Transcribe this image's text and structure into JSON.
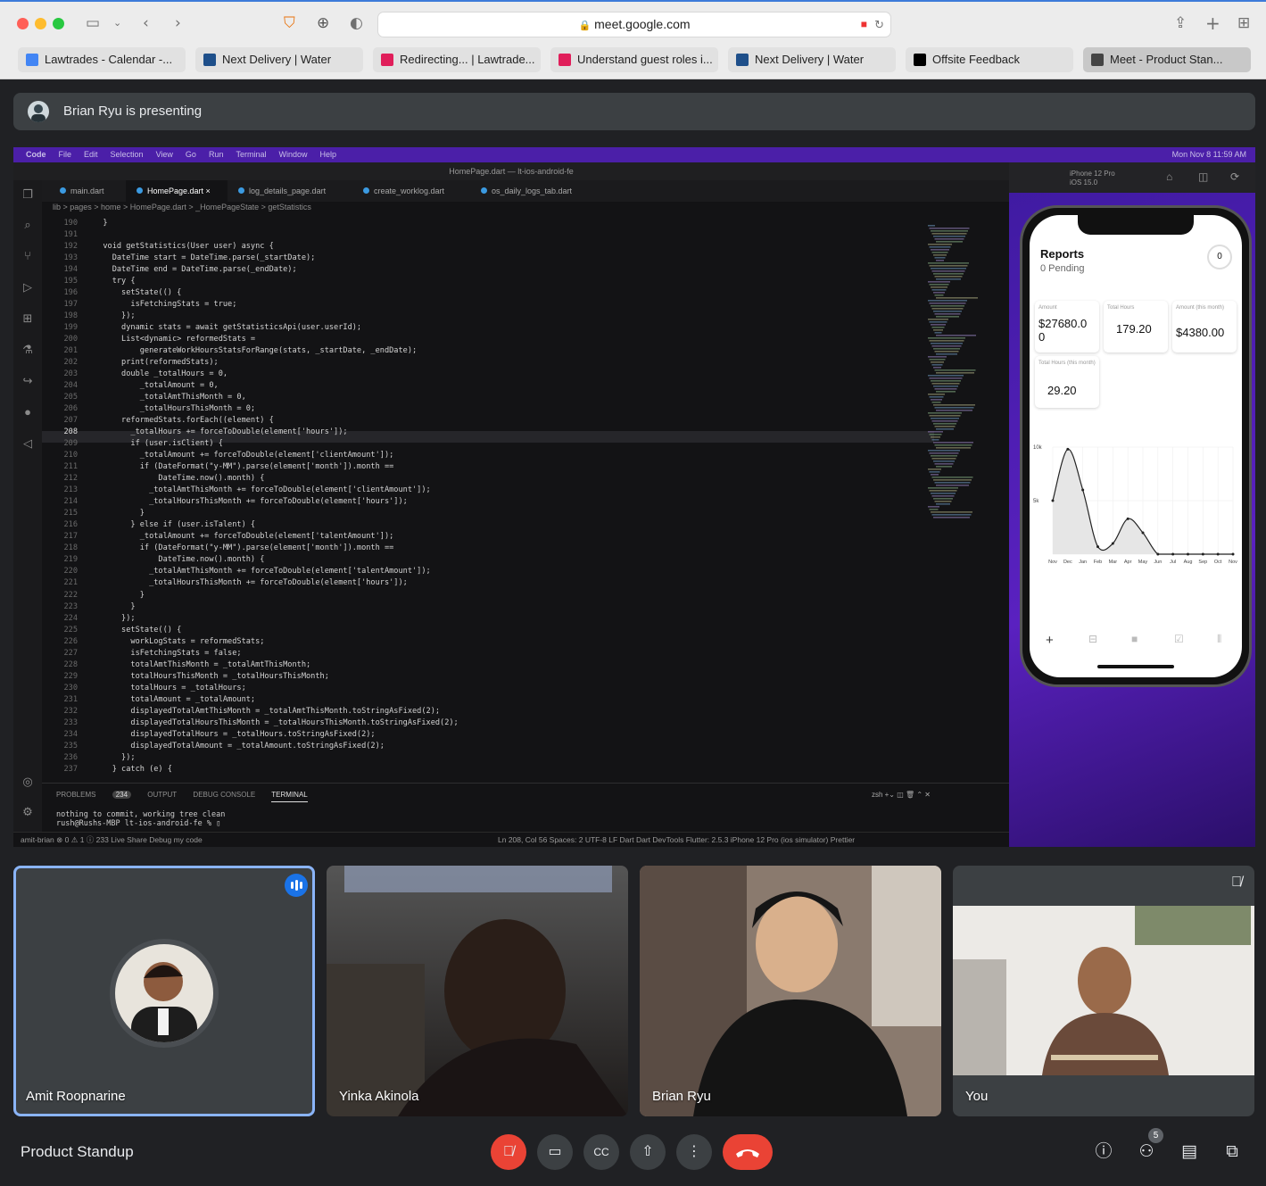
{
  "browser": {
    "url": "meet.google.com",
    "tabs": [
      {
        "label": "Lawtrades - Calendar -...",
        "color": "#4285f4"
      },
      {
        "label": "Next Delivery | Water",
        "color": "#1e4f8a"
      },
      {
        "label": "Redirecting... | Lawtrade...",
        "color": "#e01e5a"
      },
      {
        "label": "Understand guest roles i...",
        "color": "#e01e5a"
      },
      {
        "label": "Next Delivery | Water",
        "color": "#1e4f8a"
      },
      {
        "label": "Offsite Feedback",
        "color": "#000000"
      },
      {
        "label": "Meet - Product Stan...",
        "color": "#444444"
      }
    ]
  },
  "presenting": {
    "text": "Brian Ryu is presenting"
  },
  "shared": {
    "menubar": [
      "Code",
      "File",
      "Edit",
      "Selection",
      "View",
      "Go",
      "Run",
      "Terminal",
      "Window",
      "Help"
    ],
    "menubar_right": "Mon Nov 8  11:59 AM",
    "window_title": "HomePage.dart — lt-ios-android-fe",
    "editor_tabs": [
      "main.dart",
      "HomePage.dart",
      "log_details_page.dart",
      "create_worklog.dart",
      "os_daily_logs_tab.dart"
    ],
    "breadcrumb": "lib > pages > home > HomePage.dart > _HomePageState > getStatistics",
    "code_lines": [
      {
        "n": "190",
        "t": "  }"
      },
      {
        "n": "191",
        "t": ""
      },
      {
        "n": "192",
        "t": "  void getStatistics(User user) async {"
      },
      {
        "n": "193",
        "t": "    DateTime start = DateTime.parse(_startDate);"
      },
      {
        "n": "194",
        "t": "    DateTime end = DateTime.parse(_endDate);"
      },
      {
        "n": "195",
        "t": "    try {"
      },
      {
        "n": "196",
        "t": "      setState(() {"
      },
      {
        "n": "197",
        "t": "        isFetchingStats = true;"
      },
      {
        "n": "198",
        "t": "      });"
      },
      {
        "n": "199",
        "t": "      dynamic stats = await getStatisticsApi(user.userId);"
      },
      {
        "n": "200",
        "t": "      List<dynamic> reformedStats ="
      },
      {
        "n": "201",
        "t": "          generateWorkHoursStatsForRange(stats, _startDate, _endDate);"
      },
      {
        "n": "202",
        "t": "      print(reformedStats);"
      },
      {
        "n": "203",
        "t": "      double _totalHours = 0,"
      },
      {
        "n": "204",
        "t": "          _totalAmount = 0,"
      },
      {
        "n": "205",
        "t": "          _totalAmtThisMonth = 0,"
      },
      {
        "n": "206",
        "t": "          _totalHoursThisMonth = 0;"
      },
      {
        "n": "207",
        "t": "      reformedStats.forEach((element) {"
      },
      {
        "n": "208",
        "t": "        _totalHours += forceToDouble(element['hours']);"
      },
      {
        "n": "209",
        "t": "        if (user.isClient) {"
      },
      {
        "n": "210",
        "t": "          _totalAmount += forceToDouble(element['clientAmount']);"
      },
      {
        "n": "211",
        "t": "          if (DateFormat(\"y-MM\").parse(element['month']).month =="
      },
      {
        "n": "212",
        "t": "              DateTime.now().month) {"
      },
      {
        "n": "213",
        "t": "            _totalAmtThisMonth += forceToDouble(element['clientAmount']);"
      },
      {
        "n": "214",
        "t": "            _totalHoursThisMonth += forceToDouble(element['hours']);"
      },
      {
        "n": "215",
        "t": "          }"
      },
      {
        "n": "216",
        "t": "        } else if (user.isTalent) {"
      },
      {
        "n": "217",
        "t": "          _totalAmount += forceToDouble(element['talentAmount']);"
      },
      {
        "n": "218",
        "t": "          if (DateFormat(\"y-MM\").parse(element['month']).month =="
      },
      {
        "n": "219",
        "t": "              DateTime.now().month) {"
      },
      {
        "n": "220",
        "t": "            _totalAmtThisMonth += forceToDouble(element['talentAmount']);"
      },
      {
        "n": "221",
        "t": "            _totalHoursThisMonth += forceToDouble(element['hours']);"
      },
      {
        "n": "222",
        "t": "          }"
      },
      {
        "n": "223",
        "t": "        }"
      },
      {
        "n": "224",
        "t": "      });"
      },
      {
        "n": "225",
        "t": "      setState(() {"
      },
      {
        "n": "226",
        "t": "        workLogStats = reformedStats;"
      },
      {
        "n": "227",
        "t": "        isFetchingStats = false;"
      },
      {
        "n": "228",
        "t": "        totalAmtThisMonth = _totalAmtThisMonth;"
      },
      {
        "n": "229",
        "t": "        totalHoursThisMonth = _totalHoursThisMonth;"
      },
      {
        "n": "230",
        "t": "        totalHours = _totalHours;"
      },
      {
        "n": "231",
        "t": "        totalAmount = _totalAmount;"
      },
      {
        "n": "232",
        "t": "        displayedTotalAmtThisMonth = _totalAmtThisMonth.toStringAsFixed(2);"
      },
      {
        "n": "233",
        "t": "        displayedTotalHoursThisMonth = _totalHoursThisMonth.toStringAsFixed(2);"
      },
      {
        "n": "234",
        "t": "        displayedTotalHours = _totalHours.toStringAsFixed(2);"
      },
      {
        "n": "235",
        "t": "        displayedTotalAmount = _totalAmount.toStringAsFixed(2);"
      },
      {
        "n": "236",
        "t": "      });"
      },
      {
        "n": "237",
        "t": "    } catch (e) {"
      }
    ],
    "panel_tabs": {
      "problems": "PROBLEMS",
      "problems_count": "234",
      "output": "OUTPUT",
      "debug": "DEBUG CONSOLE",
      "terminal": "TERMINAL"
    },
    "terminal_text": "nothing to commit, working tree clean\nrush@Rushs-MBP lt-ios-android-fe % ▯",
    "terminal_shell": "zsh",
    "status_left": "amit-brian   ⊗ 0 ⚠ 1 ⓘ 233   Live Share   Debug my code",
    "status_right": "Ln 208, Col 56   Spaces: 2   UTF-8   LF   Dart   Dart DevTools   Flutter: 2.5.3   iPhone 12 Pro (ios simulator)   Prettier",
    "simulator": {
      "device": "iPhone 12 Pro",
      "os": "iOS 15.0",
      "title": "Reports",
      "subtitle": "0 Pending",
      "badge": "0",
      "cards": [
        {
          "label": "Amount",
          "value": "$27680.0\n0"
        },
        {
          "label": "Total Hours",
          "value": "179.20"
        },
        {
          "label": "Amount (this month)",
          "value": "$4380.00"
        },
        {
          "label": "Total Hours (this month)",
          "value": "29.20"
        }
      ]
    }
  },
  "chart_data": {
    "type": "area",
    "x": [
      "Nov",
      "Dec",
      "Jan",
      "Feb",
      "Mar",
      "Apr",
      "May",
      "Jun",
      "Jul",
      "Aug",
      "Sep",
      "Oct",
      "Nov"
    ],
    "values": [
      5000,
      9800,
      6000,
      700,
      1000,
      3300,
      2000,
      0,
      0,
      0,
      0,
      0,
      0
    ],
    "ylabels": [
      "10k",
      "5k"
    ],
    "ylim": [
      0,
      10000
    ],
    "grid": true
  },
  "participants": [
    {
      "name": "Amit Roopnarine",
      "video": false,
      "speaking": true
    },
    {
      "name": "Yinka Akinola",
      "video": true
    },
    {
      "name": "Brian Ryu",
      "video": true
    },
    {
      "name": "You",
      "video": true,
      "muted": true
    }
  ],
  "meeting": {
    "title": "Product Standup",
    "people_count": "5"
  }
}
